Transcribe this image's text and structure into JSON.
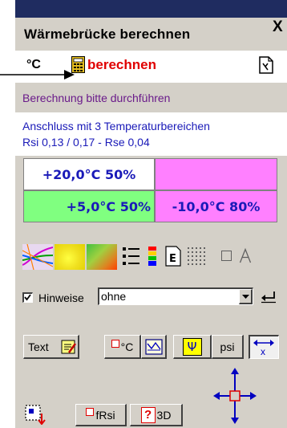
{
  "window": {
    "title": "Wärmebrücke berechnen",
    "close_glyph": "X"
  },
  "toolbar": {
    "unit_label": "°C",
    "calc_icon": "calculator-icon",
    "calc_label": "berechnen",
    "doc_icon": "document-icon"
  },
  "status": {
    "hint": "Berechnung bitte durchführen"
  },
  "info": {
    "line1": "Anschluss mit 3 Temperaturbereichen",
    "line2": "Rsi 0,13 / 0,17 - Rse 0,04"
  },
  "zones": [
    {
      "text": "+20,0°C 50%",
      "color": "#ffffff"
    },
    {
      "text": "",
      "color": "#ff80ff"
    },
    {
      "text": "+5,0°C 50%",
      "color": "#80ff80"
    },
    {
      "text": "-10,0°C 80%",
      "color": "#ff80ff"
    }
  ],
  "view_icons": [
    "isotherms-icon",
    "heatmap-yellow-icon",
    "heatmap-green-icon",
    "list-icon",
    "color-scale-icon",
    "report-icon",
    "grid-icon",
    "rectangle-icon",
    "text-a-icon"
  ],
  "hints": {
    "checkbox_label": "Hinweise",
    "checked": true,
    "select_value": "ohne"
  },
  "buttons": {
    "text_label": "Text",
    "degc_label": "°C",
    "psi_symbol": "Ψ",
    "psi_label": "psi",
    "axis_label": "x",
    "frsi_label": "fRsi",
    "q_symbol": "?",
    "threed_label": "3D"
  }
}
